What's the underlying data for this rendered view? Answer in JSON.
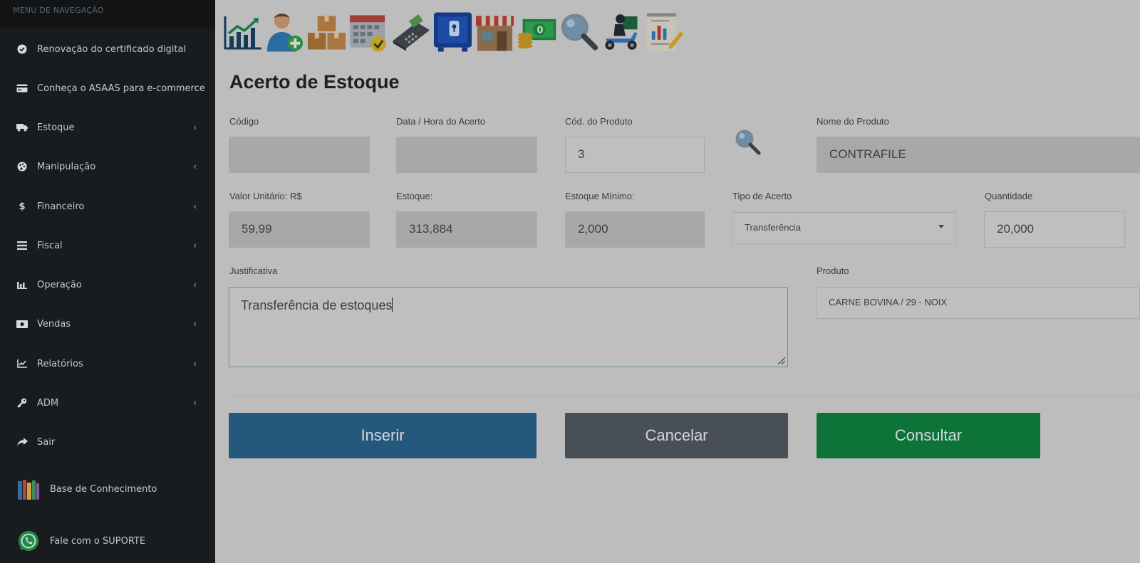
{
  "sidebar": {
    "header": "MENU DE NAVEGAÇÃO",
    "items": [
      {
        "label": "Renovação do certificado digital",
        "icon": "check-circle-icon",
        "chevron": false
      },
      {
        "label": "Conheça o ASAAS para e-commerce",
        "icon": "credit-card-icon",
        "chevron": false
      },
      {
        "label": "Estoque",
        "icon": "truck-icon",
        "chevron": true
      },
      {
        "label": "Manipulação",
        "icon": "palette-icon",
        "chevron": true
      },
      {
        "label": "Financeiro",
        "icon": "dollar-icon",
        "chevron": true
      },
      {
        "label": "Fiscal",
        "icon": "list-icon",
        "chevron": true
      },
      {
        "label": "Operação",
        "icon": "bar-chart-icon",
        "chevron": true
      },
      {
        "label": "Vendas",
        "icon": "money-icon",
        "chevron": true
      },
      {
        "label": "Relatórios",
        "icon": "line-chart-icon",
        "chevron": true
      },
      {
        "label": "ADM",
        "icon": "key-icon",
        "chevron": true
      },
      {
        "label": "Sair",
        "icon": "share-icon",
        "chevron": false
      }
    ],
    "knowledge_base": "Base de Conhecimento",
    "support": "Fale com o SUPORTE",
    "chevron_glyph": "‹"
  },
  "toolbar": {
    "icons": [
      "chart-icon",
      "add-user-icon",
      "boxes-icon",
      "calendar-icon",
      "card-machine-icon",
      "safe-icon",
      "store-icon",
      "cash-icon",
      "magnifier-icon",
      "delivery-icon",
      "report-icon"
    ]
  },
  "page": {
    "title": "Acerto de Estoque"
  },
  "form": {
    "codigo": {
      "label": "Código",
      "value": ""
    },
    "data_hora": {
      "label": "Data / Hora do Acerto",
      "value": ""
    },
    "cod_produto": {
      "label": "Cód. do Produto",
      "value": "3"
    },
    "nome_produto": {
      "label": "Nome do Produto",
      "value": "CONTRAFILE"
    },
    "valor_unitario": {
      "label": "Valor Unitário: R$",
      "value": "59,99"
    },
    "estoque": {
      "label": "Estoque:",
      "value": "313,884"
    },
    "estoque_minimo": {
      "label": "Estoque Mínimo:",
      "value": "2,000"
    },
    "tipo_acerto": {
      "label": "Tipo de Acerto",
      "value": "Transferência"
    },
    "quantidade": {
      "label": "Quantidade",
      "value": "20,000"
    },
    "justificativa": {
      "label": "Justificativa",
      "value": "Transferência de estoques"
    },
    "produto": {
      "label": "Produto",
      "value": "CARNE BOVINA / 29 - NOIX"
    }
  },
  "buttons": {
    "insert": "Inserir",
    "cancel": "Cancelar",
    "consult": "Consultar"
  }
}
